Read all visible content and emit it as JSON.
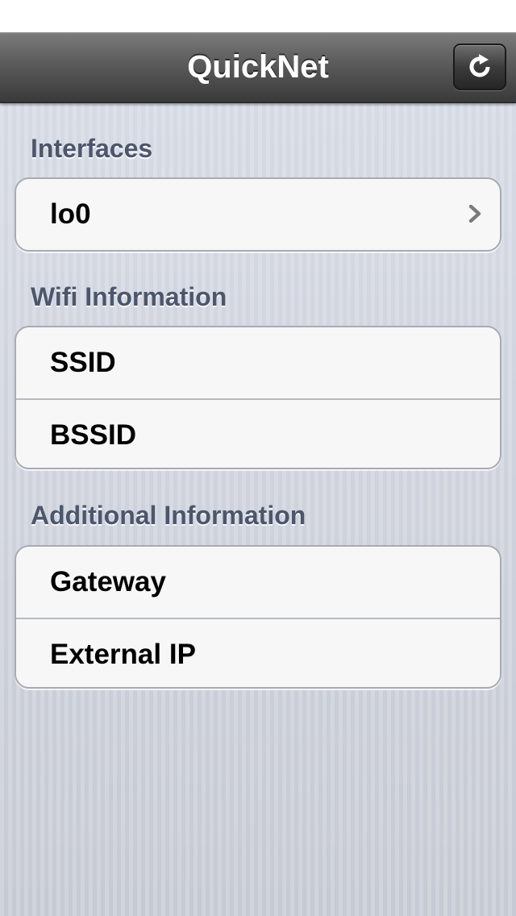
{
  "nav": {
    "title": "QuickNet",
    "refresh_icon": "refresh-icon"
  },
  "sections": {
    "interfaces": {
      "header": "Interfaces",
      "rows": [
        {
          "label": "lo0",
          "accessory": "chevron-right-icon"
        }
      ]
    },
    "wifi": {
      "header": "Wifi Information",
      "rows": [
        {
          "label": "SSID"
        },
        {
          "label": "BSSID"
        }
      ]
    },
    "additional": {
      "header": "Additional Information",
      "rows": [
        {
          "label": "Gateway"
        },
        {
          "label": "External IP"
        }
      ]
    }
  },
  "colors": {
    "section_header": "#4c566c",
    "cell_background": "#f7f7f7",
    "background": "#c7ccd6"
  }
}
